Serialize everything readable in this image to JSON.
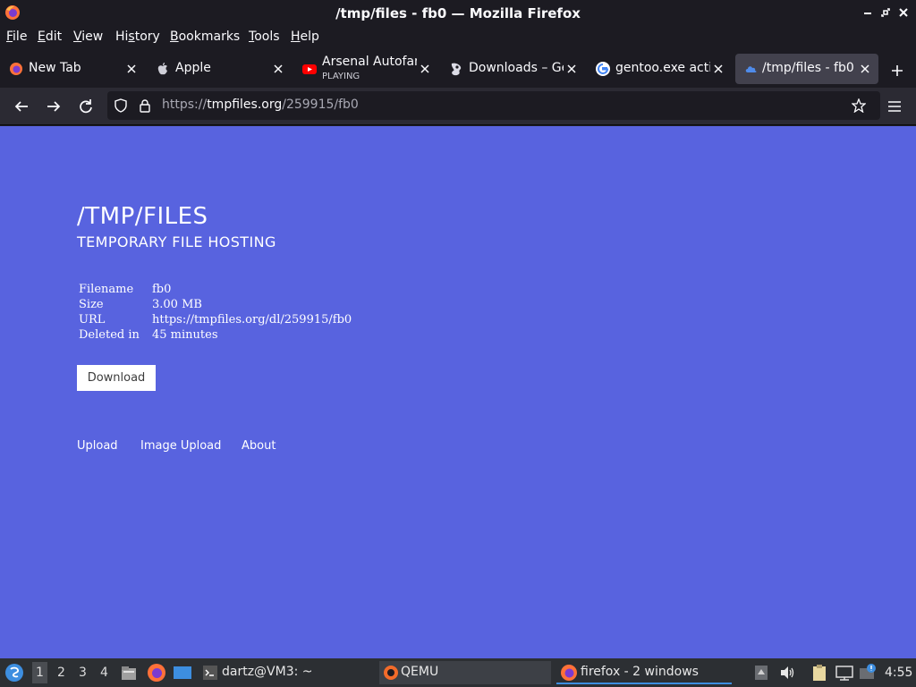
{
  "window": {
    "title": "/tmp/files - fb0 — Mozilla Firefox"
  },
  "menu": {
    "items": [
      {
        "u": "F",
        "rest": "ile"
      },
      {
        "u": "E",
        "rest": "dit"
      },
      {
        "u": "V",
        "rest": "iew"
      },
      {
        "pre": "Hi",
        "u": "s",
        "rest": "tory"
      },
      {
        "u": "B",
        "rest": "ookmarks"
      },
      {
        "u": "T",
        "rest": "ools"
      },
      {
        "u": "H",
        "rest": "elp"
      }
    ]
  },
  "tabs": [
    {
      "label": "New Tab",
      "icon": "firefox-icon"
    },
    {
      "label": "Apple",
      "icon": "apple-icon"
    },
    {
      "label": "Arsenal Autofan",
      "sub": "PLAYING",
      "icon": "youtube-icon"
    },
    {
      "label": "Downloads – Ge",
      "icon": "gentoo-icon"
    },
    {
      "label": "gentoo.exe activ",
      "icon": "google-icon"
    },
    {
      "label": "/tmp/files - fb0",
      "icon": "cloud-icon",
      "active": true
    }
  ],
  "address": {
    "scheme": "https://",
    "host": "tmpfiles.org",
    "path": "/259915/fb0"
  },
  "page": {
    "title": "/TMP/FILES",
    "subtitle": "TEMPORARY FILE HOSTING",
    "info": [
      {
        "key": "Filename",
        "value": "fb0"
      },
      {
        "key": "Size",
        "value": "3.00 MB"
      },
      {
        "key": "URL",
        "value": "https://tmpfiles.org/dl/259915/fb0"
      },
      {
        "key": "Deleted in",
        "value": "45 minutes"
      }
    ],
    "download_label": "Download",
    "footer": {
      "upload": "Upload",
      "image_upload": "Image Upload",
      "about": "About"
    }
  },
  "taskbar": {
    "workspaces": [
      "1",
      "2",
      "3",
      "4"
    ],
    "terminal_label": "dartz@VM3: ~",
    "qemu_label": "QEMU",
    "firefox_label": "firefox - 2 windows",
    "clock": "4:55"
  },
  "colors": {
    "page_bg": "#5863df",
    "chrome_bg": "#1c1b22",
    "accent": "#3d8ee0"
  }
}
